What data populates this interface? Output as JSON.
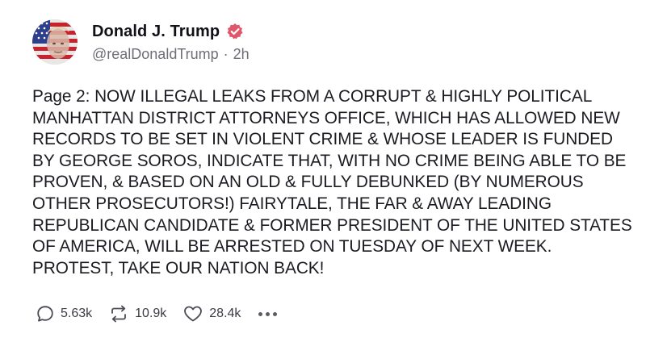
{
  "author": {
    "display_name": "Donald J. Trump",
    "handle": "@realDonaldTrump",
    "separator": "·",
    "time_ago": "2h",
    "badge_color": "#e0566b"
  },
  "post": {
    "lines": [
      "Page 2: NOW ILLEGAL LEAKS FROM A CORRUPT & HIGHLY POLITICAL",
      "MANHATTAN DISTRICT ATTORNEYS OFFICE, WHICH HAS ALLOWED NEW",
      "RECORDS TO BE SET IN VIOLENT CRIME & WHOSE LEADER IS FUNDED",
      "BY GEORGE SOROS, INDICATE THAT, WITH NO CRIME BEING ABLE TO BE",
      "PROVEN, & BASED ON AN OLD & FULLY DEBUNKED (BY NUMEROUS",
      "OTHER PROSECUTORS!) FAIRYTALE, THE FAR & AWAY LEADING",
      "REPUBLICAN CANDIDATE & FORMER PRESIDENT OF THE UNITED STATES",
      "OF AMERICA, WILL BE ARRESTED ON TUESDAY OF NEXT WEEK.",
      "PROTEST, TAKE OUR NATION BACK!"
    ]
  },
  "actions": {
    "replies": "5.63k",
    "retruths": "10.9k",
    "likes": "28.4k",
    "reply_icon": "comment-icon",
    "retruth_icon": "repost-icon",
    "like_icon": "heart-icon",
    "more_icon": "more-dots-icon"
  }
}
